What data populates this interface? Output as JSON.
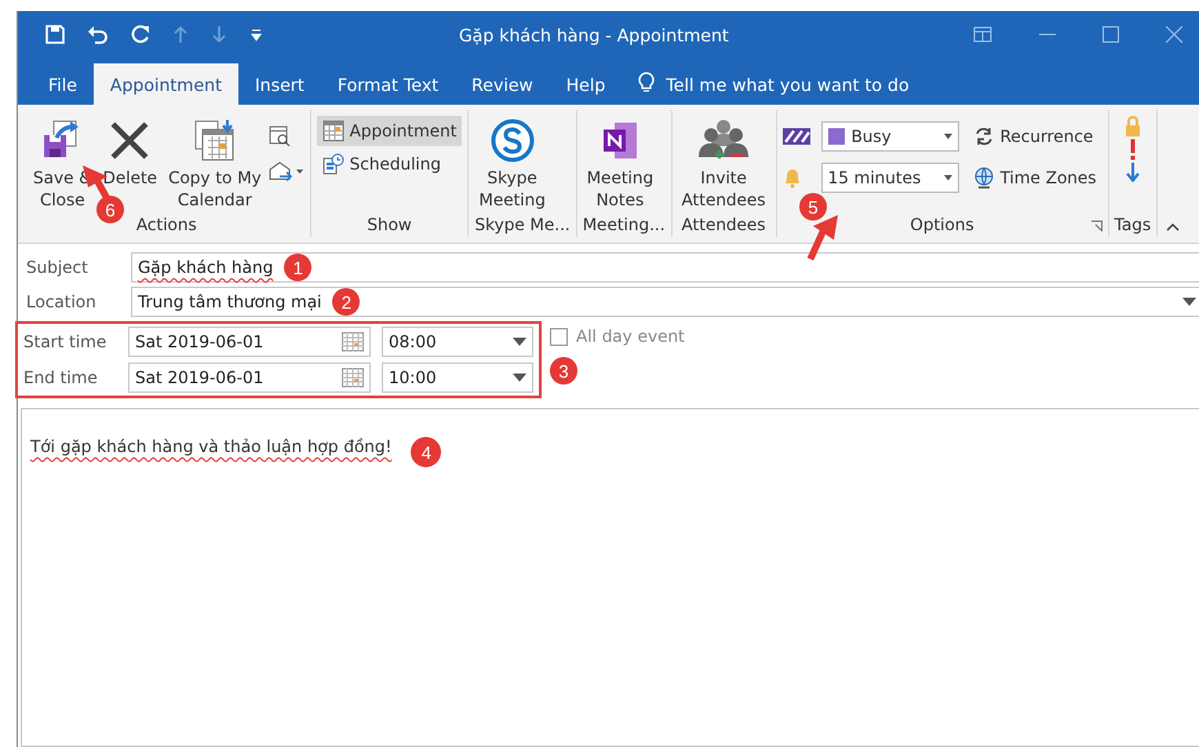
{
  "window": {
    "title": "Gặp khách hàng  -  Appointment"
  },
  "tabs": [
    {
      "label": "File",
      "selected": false
    },
    {
      "label": "Appointment",
      "selected": true
    },
    {
      "label": "Insert",
      "selected": false
    },
    {
      "label": "Format Text",
      "selected": false
    },
    {
      "label": "Review",
      "selected": false
    },
    {
      "label": "Help",
      "selected": false
    }
  ],
  "tell_me": {
    "placeholder": "Tell me what you want to do"
  },
  "ribbon": {
    "actions": {
      "label": "Actions",
      "save": "Save &",
      "save_2": "Close",
      "delete": "Delete",
      "copy": "Copy to My",
      "copy_2": "Calendar"
    },
    "show": {
      "label": "Show",
      "items": [
        {
          "label": "Appointment",
          "selected": true
        },
        {
          "label": "Scheduling",
          "selected": false
        }
      ]
    },
    "skype": {
      "label": "Skype Me...",
      "button": "Skype",
      "button_2": "Meeting"
    },
    "notes": {
      "label": "Meeting...",
      "button": "Meeting",
      "button_2": "Notes"
    },
    "attendees": {
      "label": "Attendees",
      "button": "Invite",
      "button_2": "Attendees"
    },
    "options": {
      "label": "Options",
      "show_as": "Busy",
      "reminder": "15 minutes",
      "recurrence": "Recurrence",
      "time_zones": "Time Zones"
    },
    "tags": {
      "label": "Tags"
    }
  },
  "form": {
    "subject": {
      "label": "Subject",
      "value": "Gặp khách hàng"
    },
    "location": {
      "label": "Location",
      "value": "Trung tâm thương mại"
    },
    "start": {
      "label": "Start time",
      "date": "Sat 2019-06-01",
      "time": "08:00"
    },
    "end": {
      "label": "End time",
      "date": "Sat 2019-06-01",
      "time": "10:00"
    },
    "all_day": {
      "label": "All day event",
      "checked": false
    },
    "body": "Tới gặp khách hàng và thảo luận hợp đồng!"
  },
  "callouts": [
    "1",
    "2",
    "3",
    "4",
    "5",
    "6"
  ]
}
